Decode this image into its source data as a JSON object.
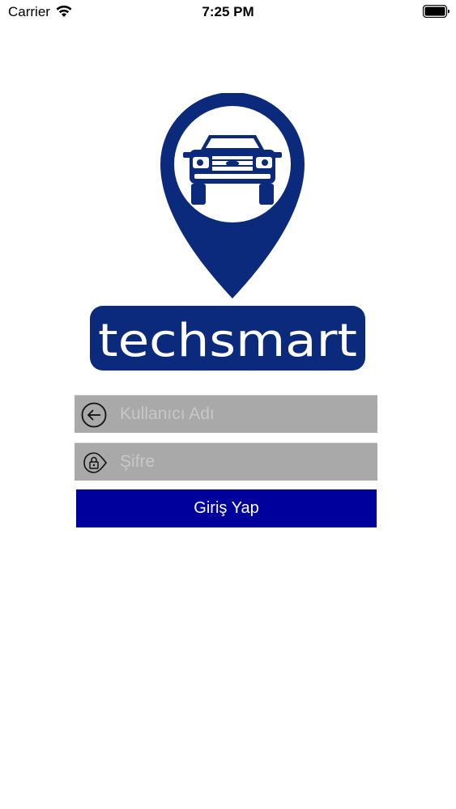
{
  "status_bar": {
    "carrier": "Carrier",
    "time": "7:25 PM"
  },
  "brand": {
    "name": "techsmart",
    "color": "#0b2a7c"
  },
  "login_form": {
    "username_placeholder": "Kullanıcı Adı",
    "password_placeholder": "Şifre",
    "submit_label": "Giriş Yap",
    "button_color": "#00009c",
    "field_color": "#a9a9a9"
  },
  "icons": [
    "wifi-icon",
    "battery-icon",
    "back-arrow-icon",
    "lock-tag-icon",
    "car-icon",
    "location-pin-icon"
  ]
}
